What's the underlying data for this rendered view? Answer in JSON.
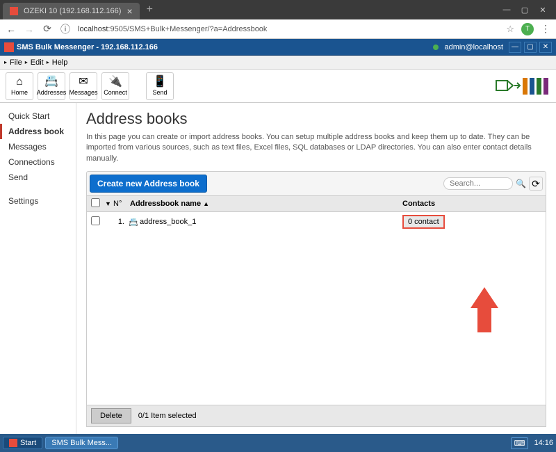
{
  "browser": {
    "tab_title": "OZEKI 10 (192.168.112.166)",
    "url_prefix": "localhost",
    "url_path": ":9505/SMS+Bulk+Messenger/?a=Addressbook",
    "profile_letter": "T"
  },
  "app_header": {
    "title": "SMS Bulk Messenger - 192.168.112.166",
    "user": "admin@localhost"
  },
  "menus": {
    "file": "File",
    "edit": "Edit",
    "help": "Help"
  },
  "toolbar": {
    "home": "Home",
    "addresses": "Addresses",
    "messages": "Messages",
    "connect": "Connect",
    "send": "Send"
  },
  "sidebar": {
    "items": [
      "Quick Start",
      "Address book",
      "Messages",
      "Connections",
      "Send",
      "Settings"
    ]
  },
  "page": {
    "title": "Address books",
    "desc": "In this page you can create or import address books. You can setup multiple address books and keep them up to date. They can be imported from various sources, such as text files, Excel files, SQL databases or LDAP directories. You can also enter contact details manually.",
    "create_btn": "Create new Address book",
    "search_placeholder": "Search...",
    "th_num": "N°",
    "th_name": "Addressbook name",
    "th_contacts": "Contacts",
    "rows": [
      {
        "num": "1.",
        "name": "address_book_1",
        "contacts": "0 contact"
      }
    ],
    "delete_btn": "Delete",
    "selected_text": "0/1 Item selected"
  },
  "taskbar": {
    "start": "Start",
    "task1": "SMS Bulk Mess...",
    "clock": "14:16"
  }
}
